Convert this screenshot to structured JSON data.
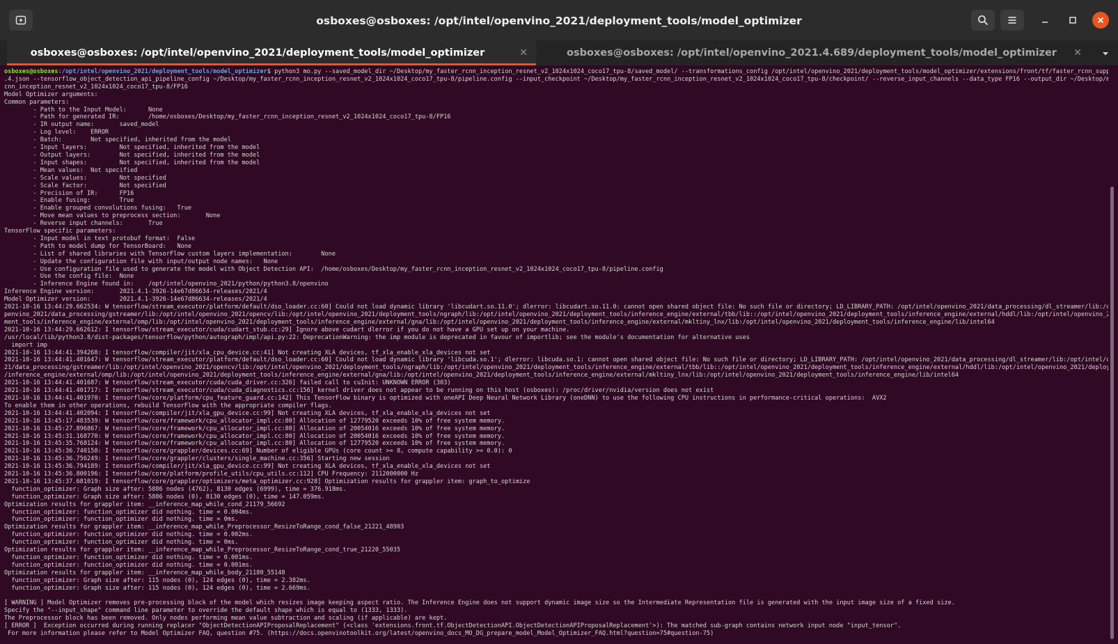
{
  "window": {
    "title": "osboxes@osboxes: /opt/intel/openvino_2021/deployment_tools/model_optimizer",
    "icons": {
      "new_tab": "new-tab-icon",
      "search": "search-icon",
      "menu": "hamburger-menu-icon",
      "minimize": "minimize-icon",
      "maximize": "maximize-icon",
      "close": "close-icon"
    }
  },
  "tabs": [
    {
      "label": "osboxes@osboxes: /opt/intel/openvino_2021/deployment_tools/model_optimizer",
      "active": true
    },
    {
      "label": "osboxes@osboxes: /opt/intel/openvino_2021.4.689/deployment_tools/model_optimizer",
      "active": false
    }
  ],
  "colors": {
    "terminal_bg": "#300a24",
    "accent": "#e95420",
    "prompt_user": "#8ae234",
    "prompt_path": "#729fcf"
  },
  "terminal": {
    "prompt_user": "osboxes@osboxes",
    "prompt_sep": ":",
    "prompt_path": "/opt/intel/openvino_2021/deployment_tools/model_optimizer",
    "command": "$ python3 mo.py --saved_model_dir ~/Desktop/my_faster_rcnn_inception_resnet_v2_1024x1024_coco17_tpu-8/saved_model/ --transformations_config /opt/intel/openvino_2021/deployment_tools/model_optimizer/extensions/front/tf/faster_rcnn_support_api_v2\n.4.json --tensorflow_object_detection_api_pipeline_config ~/Desktop/my_faster_rcnn_inception_resnet_v2_1024x1024_coco17_tpu-8/pipeline.config --input_checkpoint ~/Desktop/my_faster_rcnn_inception_resnet_v2_1024x1024_coco17_tpu-8/checkpoint/ --reverse_input_channels --data_type FP16 --output_dir ~/Desktop/my_faster_r\ncnn_inception_resnet_v2_1024x1024_coco17_tpu-8/FP16",
    "output": "Model Optimizer arguments:\nCommon parameters:\n        - Path to the Input Model:      None\n        - Path for generated IR:        /home/osboxes/Desktop/my_faster_rcnn_inception_resnet_v2_1024x1024_coco17_tpu-8/FP16\n        - IR output name:       saved_model\n        - Log level:    ERROR\n        - Batch:        Not specified, inherited from the model\n        - Input layers:         Not specified, inherited from the model\n        - Output layers:        Not specified, inherited from the model\n        - Input shapes:         Not specified, inherited from the model\n        - Mean values:  Not specified\n        - Scale values:         Not specified\n        - Scale factor:         Not specified\n        - Precision of IR:      FP16\n        - Enable fusing:        True\n        - Enable grouped convolutions fusing:   True\n        - Move mean values to preprocess section:       None\n        - Reverse input channels:       True\nTensorFlow specific parameters:\n        - Input model in text protobuf format:  False\n        - Path to model dump for TensorBoard:   None\n        - List of shared libraries with TensorFlow custom layers implementation:        None\n        - Update the configuration file with input/output node names:   None\n        - Use configuration file used to generate the model with Object Detection API:  /home/osboxes/Desktop/my_faster_rcnn_inception_resnet_v2_1024x1024_coco17_tpu-8/pipeline.config\n        - Use the config file:  None\n        - Inference Engine found in:    /opt/intel/openvino_2021/python/python3.8/openvino\nInference Engine version:       2021.4.1-3926-14e67d86634-releases/2021/4\nModel Optimizer version:        2021.4.1-3926-14e67d86634-releases/2021/4\n2021-10-16 13:44:29.662534: W tensorflow/stream_executor/platform/default/dso_loader.cc:60] Could not load dynamic library 'libcudart.so.11.0'; dlerror: libcudart.so.11.0: cannot open shared object file: No such file or directory; LD_LIBRARY_PATH: /opt/intel/openvino_2021/data_processing/dl_streamer/lib:/opt/intel/o\npenvino_2021/data_processing/gstreamer/lib:/opt/intel/openvino_2021/opencv/lib:/opt/intel/openvino_2021/deployment_tools/ngraph/lib:/opt/intel/openvino_2021/deployment_tools/inference_engine/external/tbb/lib::/opt/intel/openvino_2021/deployment_tools/inference_engine/external/hddl/lib:/opt/intel/openvino_2021/deploy\nment_tools/inference_engine/external/omp/lib:/opt/intel/openvino_2021/deployment_tools/inference_engine/external/gna/lib:/opt/intel/openvino_2021/deployment_tools/inference_engine/external/mkltiny_lnx/lib:/opt/intel/openvino_2021/deployment_tools/inference_engine/lib/intel64\n2021-10-16 13:44:29.662612: I tensorflow/stream_executor/cuda/cudart_stub.cc:29] Ignore above cudart dlerror if you do not have a GPU set up on your machine.\n/usr/local/lib/python3.8/dist-packages/tensorflow/python/autograph/impl/api.py:22: DeprecationWarning: the imp module is deprecated in favour of importlib; see the module's documentation for alternative uses\n  import imp\n2021-10-16 13:44:41.394268: I tensorflow/compiler/jit/xla_cpu_device.cc:41] Not creating XLA devices, tf_xla_enable_xla_devices not set\n2021-10-16 13:44:41.401647: W tensorflow/stream_executor/platform/default/dso_loader.cc:60] Could not load dynamic library 'libcuda.so.1'; dlerror: libcuda.so.1: cannot open shared object file: No such file or directory; LD_LIBRARY_PATH: /opt/intel/openvino_2021/data_processing/dl_streamer/lib:/opt/intel/openvino_20\n21/data_processing/gstreamer/lib:/opt/intel/openvino_2021/opencv/lib:/opt/intel/openvino_2021/deployment_tools/ngraph/lib:/opt/intel/openvino_2021/deployment_tools/inference_engine/external/tbb/lib::/opt/intel/openvino_2021/deployment_tools/inference_engine/external/hddl/lib:/opt/intel/openvino_2021/deployment_tools\n/inference_engine/external/omp/lib:/opt/intel/openvino_2021/deployment_tools/inference_engine/external/gna/lib:/opt/intel/openvino_2021/deployment_tools/inference_engine/external/mkltiny_lnx/lib:/opt/intel/openvino_2021/deployment_tools/inference_engine/lib/intel64\n2021-10-16 13:44:41.401687: W tensorflow/stream_executor/cuda/cuda_driver.cc:326] failed call to cuInit: UNKNOWN ERROR (303)\n2021-10-16 13:44:41.401717: I tensorflow/stream_executor/cuda/cuda_diagnostics.cc:156] kernel driver does not appear to be running on this host (osboxes): /proc/driver/nvidia/version does not exist\n2021-10-16 13:44:41.401970: I tensorflow/core/platform/cpu_feature_guard.cc:142] This TensorFlow binary is optimized with oneAPI Deep Neural Network Library (oneDNN) to use the following CPU instructions in performance-critical operations:  AVX2\nTo enable them in other operations, rebuild TensorFlow with the appropriate compiler flags.\n2021-10-16 13:44:41.402094: I tensorflow/compiler/jit/xla_gpu_device.cc:99] Not creating XLA devices, tf_xla_enable_xla_devices not set\n2021-10-16 13:45:17.483539: W tensorflow/core/framework/cpu_allocator_impl.cc:80] Allocation of 12779520 exceeds 10% of free system memory.\n2021-10-16 13:45:27.896867: W tensorflow/core/framework/cpu_allocator_impl.cc:80] Allocation of 20054016 exceeds 10% of free system memory.\n2021-10-16 13:45:31.168770: W tensorflow/core/framework/cpu_allocator_impl.cc:80] Allocation of 20054016 exceeds 10% of free system memory.\n2021-10-16 13:45:35.768124: W tensorflow/core/framework/cpu_allocator_impl.cc:80] Allocation of 12779520 exceeds 10% of free system memory.\n2021-10-16 13:45:36.740158: I tensorflow/core/grappler/devices.cc:69] Number of eligible GPUs (core count >= 8, compute capability >= 0.0): 0\n2021-10-16 13:45:36.756249: I tensorflow/core/grappler/clusters/single_machine.cc:356] Starting new session\n2021-10-16 13:45:36.794189: I tensorflow/compiler/jit/xla_gpu_device.cc:99] Not creating XLA devices, tf_xla_enable_xla_devices not set\n2021-10-16 13:45:36.800196: I tensorflow/core/platform/profile_utils/cpu_utils.cc:112] CPU Frequency: 2112000000 Hz\n2021-10-16 13:45:37.681019: I tensorflow/core/grappler/optimizers/meta_optimizer.cc:928] Optimization results for grappler item: graph_to_optimize\n  function_optimizer: Graph size after: 5886 nodes (4762), 8130 edges (6999), time = 376.918ms.\n  function_optimizer: Graph size after: 5886 nodes (0), 8130 edges (0), time = 147.059ms.\nOptimization results for grappler item: __inference_map_while_cond_21179_56692\n  function_optimizer: function_optimizer did nothing. time = 0.004ms.\n  function_optimizer: function_optimizer did nothing. time = 0ms.\nOptimization results for grappler item: __inference_map_while_Preprocessor_ResizeToRange_cond_false_21221_48903\n  function_optimizer: function_optimizer did nothing. time = 0.002ms.\n  function_optimizer: function_optimizer did nothing. time = 0ms.\nOptimization results for grappler item: __inference_map_while_Preprocessor_ResizeToRange_cond_true_21220_55035\n  function_optimizer: function_optimizer did nothing. time = 0.001ms.\n  function_optimizer: function_optimizer did nothing. time = 0.001ms.\nOptimization results for grappler item: __inference_map_while_body_21180_55148\n  function_optimizer: Graph size after: 115 nodes (0), 124 edges (0), time = 2.382ms.\n  function_optimizer: Graph size after: 115 nodes (0), 124 edges (0), time = 2.669ms.\n\n[ WARNING ] Model Optimizer removes pre-processing block of the model which resizes image keeping aspect ratio. The Inference Engine does not support dynamic image size so the Intermediate Representation file is generated with the input image size of a fixed size.\nSpecify the \"--input_shape\" command line parameter to override the default shape which is equal to (1333, 1333).\nThe Preprocessor block has been removed. Only nodes performing mean value subtraction and scaling (if applicable) are kept.\n[ ERROR ]  Exception occurred during running replacer \"ObjectDetectionAPIProposalReplacement\" (<class 'extensions.front.tf.ObjectDetectionAPI.ObjectDetectionAPIProposalReplacement'>): The matched sub-graph contains network input node \"input_tensor\".\n For more information please refer to Model Optimizer FAQ, question #75. (https://docs.openvinotoolkit.org/latest/openvino_docs_MO_DG_prepare_model_Model_Optimizer_FAQ.html?question=75#question-75)"
  }
}
